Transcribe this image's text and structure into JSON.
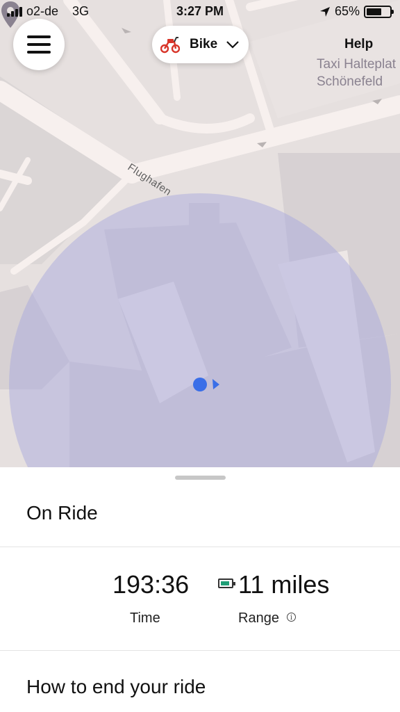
{
  "status_bar": {
    "carrier": "o2-de",
    "network": "3G",
    "time": "3:27 PM",
    "battery_percent": "65%",
    "battery_level": 0.65,
    "icons": [
      "signal-icon",
      "location-arrow-icon",
      "battery-icon"
    ]
  },
  "map": {
    "mode_label": "Bike",
    "mode_icon": "scooter-icon",
    "help_label": "Help",
    "poi_name_line1": "Taxi Halteplat",
    "poi_name_line2": "Schönefeld",
    "road_name": "Flughafen",
    "colors": {
      "accuracy_circle": "#a9aadd",
      "location_dot": "#3a6ee8",
      "roads": "#f4ecea",
      "background": "#e6e0df"
    }
  },
  "ride": {
    "status_title": "On Ride",
    "time_value": "193:36",
    "time_label": "Time",
    "range_value": "11 miles",
    "range_label": "Range",
    "range_info_icon": "info-icon",
    "howto_title": "How to end your ride"
  }
}
